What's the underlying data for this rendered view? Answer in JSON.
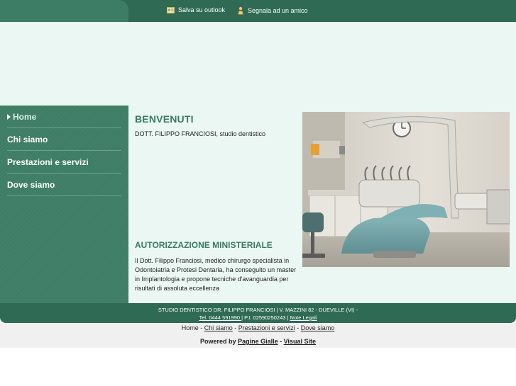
{
  "header": {
    "outlook_label": "Salva su outlook",
    "friend_label": "Segnala ad un amico"
  },
  "sidebar": {
    "items": [
      {
        "label": "Home"
      },
      {
        "label": "Chi siamo"
      },
      {
        "label": "Prestazioni e servizi"
      },
      {
        "label": "Dove siamo"
      }
    ]
  },
  "main": {
    "welcome": "BENVENUTI",
    "subtitle": "DOTT. FILIPPO FRANCIOSI, studio dentistico",
    "auth_title": "AUTORIZZAZIONE MINISTERIALE",
    "auth_body": "Il Dott. Filippo Franciosi, medico chirurgo specialista in Odontoiatria e Protesi Dentaria, ha conseguito un master in Implantologia e propone tecniche d'avanguardia per risultati di assoluta eccellenza"
  },
  "footer": {
    "line1": "STUDIO DENTISTICO DR. FILIPPO FRANCIOSI | V. MAZZINI 82 - DUEVILLE (VI) -",
    "tel": "Tel. 0444 591990 ",
    "piva": " | P.I. 02590250243 | ",
    "legal": "Note Legali"
  },
  "bottom_nav": {
    "home": "Home",
    "sep": " - ",
    "chi_siamo": "Chi siamo",
    "prestazioni": "Prestazioni e servizi",
    "dove_siamo": "Dove siamo",
    "powered_by": "Powered by ",
    "pagine_gialle": "Pagine Gialle",
    "visual_site": "Visual Site"
  },
  "colors": {
    "dark_green": "#2f6a55",
    "sidebar_green": "#3e7d66",
    "light_bg": "#eaf7f2",
    "heading_green": "#3b7a64"
  }
}
